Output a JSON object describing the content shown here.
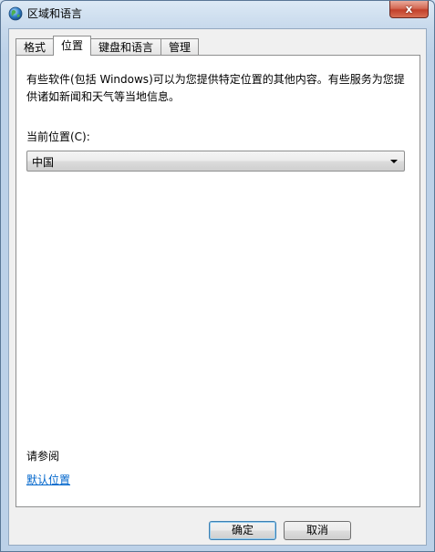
{
  "window": {
    "title": "区域和语言",
    "close_label": "x"
  },
  "tabs": [
    {
      "label": "格式",
      "active": false
    },
    {
      "label": "位置",
      "active": true
    },
    {
      "label": "键盘和语言",
      "active": false
    },
    {
      "label": "管理",
      "active": false
    }
  ],
  "location": {
    "description": "有些软件(包括 Windows)可以为您提供特定位置的其他内容。有些服务为您提供诸如新闻和天气等当地信息。",
    "current_label": "当前位置(C):",
    "current_value": "中国"
  },
  "see_also": {
    "heading": "请参阅",
    "link": "默认位置"
  },
  "buttons": {
    "ok": "确定",
    "cancel": "取消"
  },
  "colors": {
    "link": "#0066cc",
    "close_button": "#c2402b"
  },
  "icons": {
    "title": "globe-icon",
    "dropdown": "chevron-down-icon"
  }
}
